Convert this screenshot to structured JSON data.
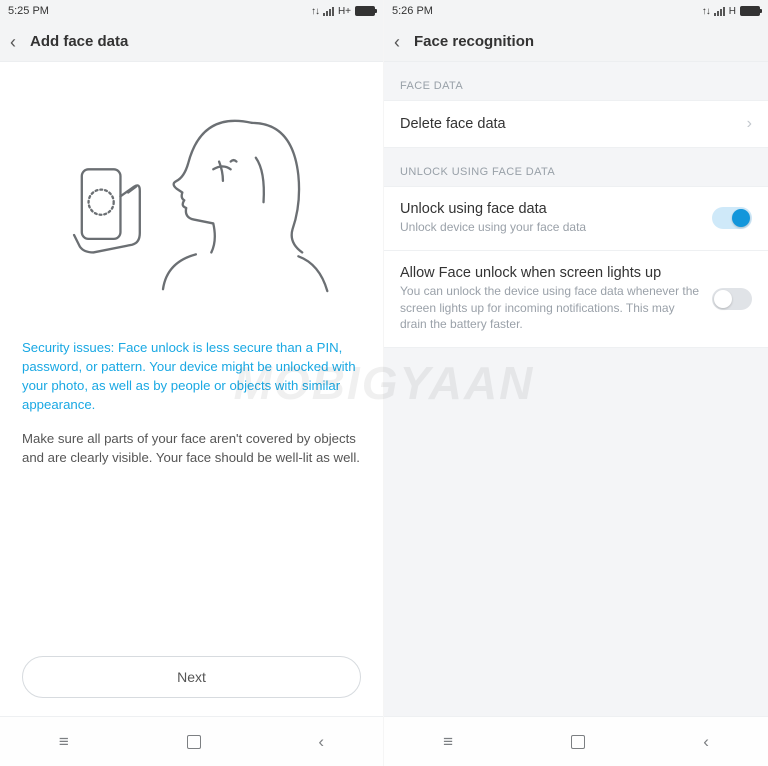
{
  "watermark": "MOBIGYAAN",
  "left": {
    "status_time": "5:25 PM",
    "network_label": "H+",
    "header_title": "Add face data",
    "security_warning": "Security issues: Face unlock is less secure than a PIN, password, or pattern. Your device might be unlocked with your photo, as well as by people or objects with similar appearance.",
    "tip_text": "Make sure all parts of your face aren't covered by objects and are clearly visible. Your face should be well-lit as well.",
    "next_label": "Next"
  },
  "right": {
    "status_time": "5:26 PM",
    "network_label": "H",
    "header_title": "Face recognition",
    "section1_label": "FACE DATA",
    "delete_label": "Delete face data",
    "section2_label": "UNLOCK USING FACE DATA",
    "unlock_title": "Unlock using face data",
    "unlock_sub": "Unlock device using your face data",
    "unlock_state": "on",
    "allow_title": "Allow Face unlock when screen lights up",
    "allow_sub": "You can unlock the device using face data whenever the screen lights up for incoming notifications. This may drain the battery faster.",
    "allow_state": "off"
  }
}
